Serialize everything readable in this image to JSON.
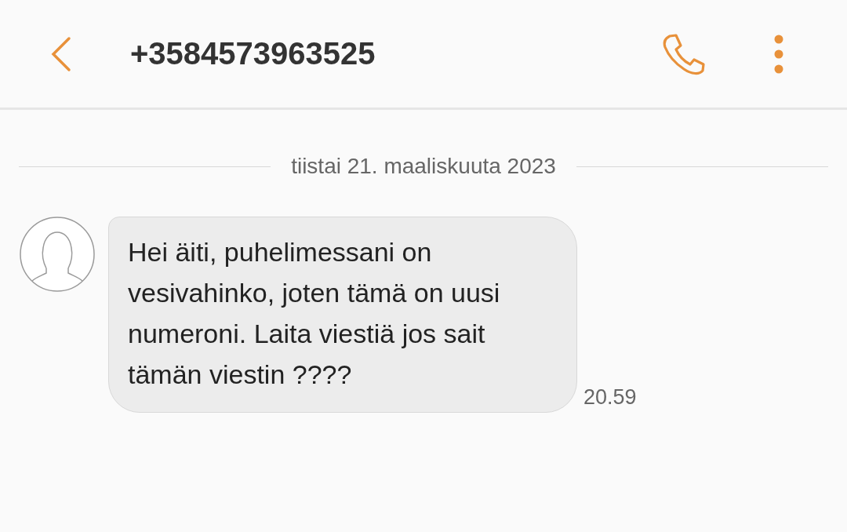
{
  "header": {
    "title": "+3584573963525"
  },
  "date_divider": "tiistai 21. maaliskuuta 2023",
  "messages": [
    {
      "text": "Hei äiti, puhelimessani on vesivahinko, joten tämä on uusi numeroni. Laita viestiä jos sait tämän viestin ????",
      "time": "20.59"
    }
  ]
}
